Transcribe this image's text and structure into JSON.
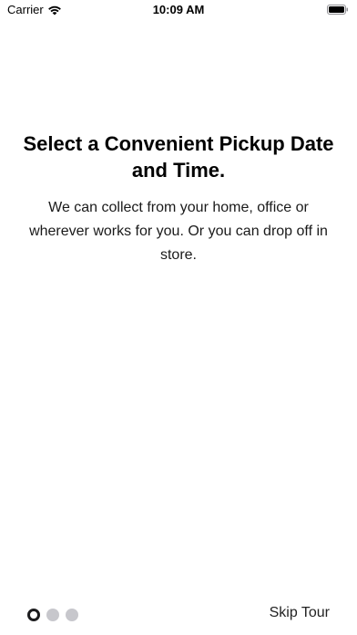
{
  "status_bar": {
    "carrier": "Carrier",
    "time": "10:09 AM",
    "wifi_icon": "wifi-icon",
    "battery_icon": "battery-icon"
  },
  "onboarding": {
    "title": "Select a Convenient Pickup Date and Time.",
    "body": "We can collect from your home, office or wherever works for you. Or you can drop off in store."
  },
  "pager": {
    "page_count": 3,
    "current_page": 1
  },
  "footer": {
    "skip_label": "Skip Tour"
  },
  "colors": {
    "dot_active": "#1c1c1e",
    "dot_inactive": "#c7c7cc",
    "text": "#000000"
  }
}
